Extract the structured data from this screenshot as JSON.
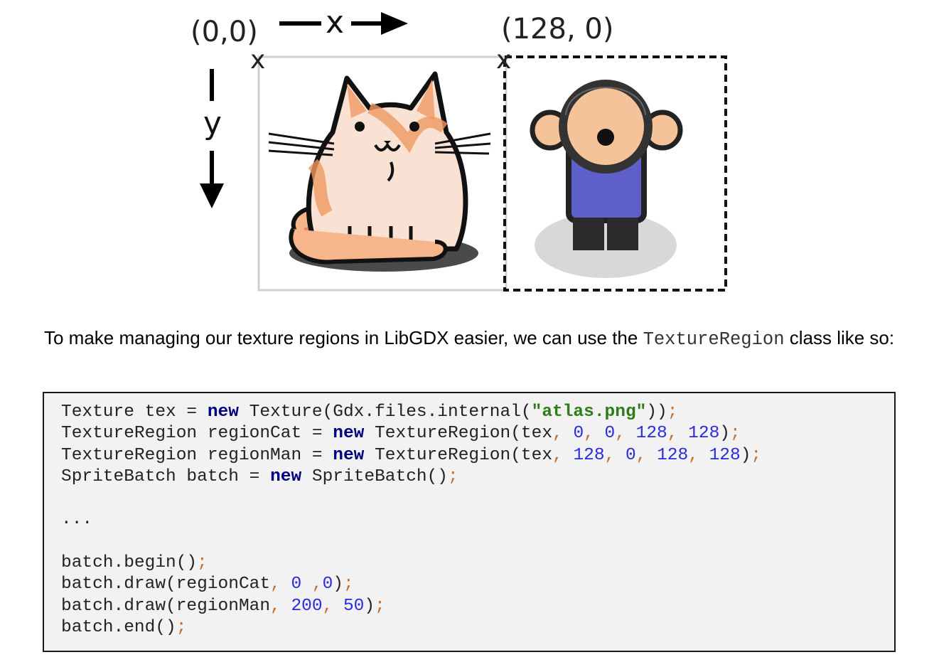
{
  "diagram": {
    "origin_label": "(0,0)",
    "second_origin_label": "(128, 0)",
    "x_axis_label": "x",
    "y_axis_label": "y",
    "marker_glyph": "x",
    "cat_sprite_icon": "cat-sprite-icon",
    "man_sprite_icon": "man-sprite-icon"
  },
  "text": {
    "before": "To make managing our texture regions in LibGDX easier, we can use the ",
    "inline_code": "TextureRegion",
    "after": " class like so:"
  },
  "code": {
    "lines": [
      [
        [
          "Texture tex = ",
          "t"
        ],
        [
          "new",
          "kw"
        ],
        [
          " Texture(Gdx.files.internal(",
          "t"
        ],
        [
          "\"atlas.png\"",
          "str"
        ],
        [
          "))",
          "t"
        ],
        [
          ";",
          "pn"
        ]
      ],
      [
        [
          "TextureRegion regionCat = ",
          "t"
        ],
        [
          "new",
          "kw"
        ],
        [
          " TextureRegion(tex",
          "t"
        ],
        [
          ",",
          "pn"
        ],
        [
          " ",
          "t"
        ],
        [
          "0",
          "num"
        ],
        [
          ",",
          "pn"
        ],
        [
          " ",
          "t"
        ],
        [
          "0",
          "num"
        ],
        [
          ",",
          "pn"
        ],
        [
          " ",
          "t"
        ],
        [
          "128",
          "num"
        ],
        [
          ",",
          "pn"
        ],
        [
          " ",
          "t"
        ],
        [
          "128",
          "num"
        ],
        [
          ")",
          "t"
        ],
        [
          ";",
          "pn"
        ]
      ],
      [
        [
          "TextureRegion regionMan = ",
          "t"
        ],
        [
          "new",
          "kw"
        ],
        [
          " TextureRegion(tex",
          "t"
        ],
        [
          ",",
          "pn"
        ],
        [
          " ",
          "t"
        ],
        [
          "128",
          "num"
        ],
        [
          ",",
          "pn"
        ],
        [
          " ",
          "t"
        ],
        [
          "0",
          "num"
        ],
        [
          ",",
          "pn"
        ],
        [
          " ",
          "t"
        ],
        [
          "128",
          "num"
        ],
        [
          ",",
          "pn"
        ],
        [
          " ",
          "t"
        ],
        [
          "128",
          "num"
        ],
        [
          ")",
          "t"
        ],
        [
          ";",
          "pn"
        ]
      ],
      [
        [
          "SpriteBatch batch = ",
          "t"
        ],
        [
          "new",
          "kw"
        ],
        [
          " SpriteBatch()",
          "t"
        ],
        [
          ";",
          "pn"
        ]
      ],
      [],
      [
        [
          "...",
          "t"
        ]
      ],
      [],
      [
        [
          "batch.begin()",
          "t"
        ],
        [
          ";",
          "pn"
        ]
      ],
      [
        [
          "batch.draw(regionCat",
          "t"
        ],
        [
          ",",
          "pn"
        ],
        [
          " ",
          "t"
        ],
        [
          "0",
          "num"
        ],
        [
          " ,",
          "pn"
        ],
        [
          "0",
          "num"
        ],
        [
          ")",
          "t"
        ],
        [
          ";",
          "pn"
        ]
      ],
      [
        [
          "batch.draw(regionMan",
          "t"
        ],
        [
          ",",
          "pn"
        ],
        [
          " ",
          "t"
        ],
        [
          "200",
          "num"
        ],
        [
          ",",
          "pn"
        ],
        [
          " ",
          "t"
        ],
        [
          "50",
          "num"
        ],
        [
          ")",
          "t"
        ],
        [
          ";",
          "pn"
        ]
      ],
      [
        [
          "batch.end()",
          "t"
        ],
        [
          ";",
          "pn"
        ]
      ]
    ]
  }
}
